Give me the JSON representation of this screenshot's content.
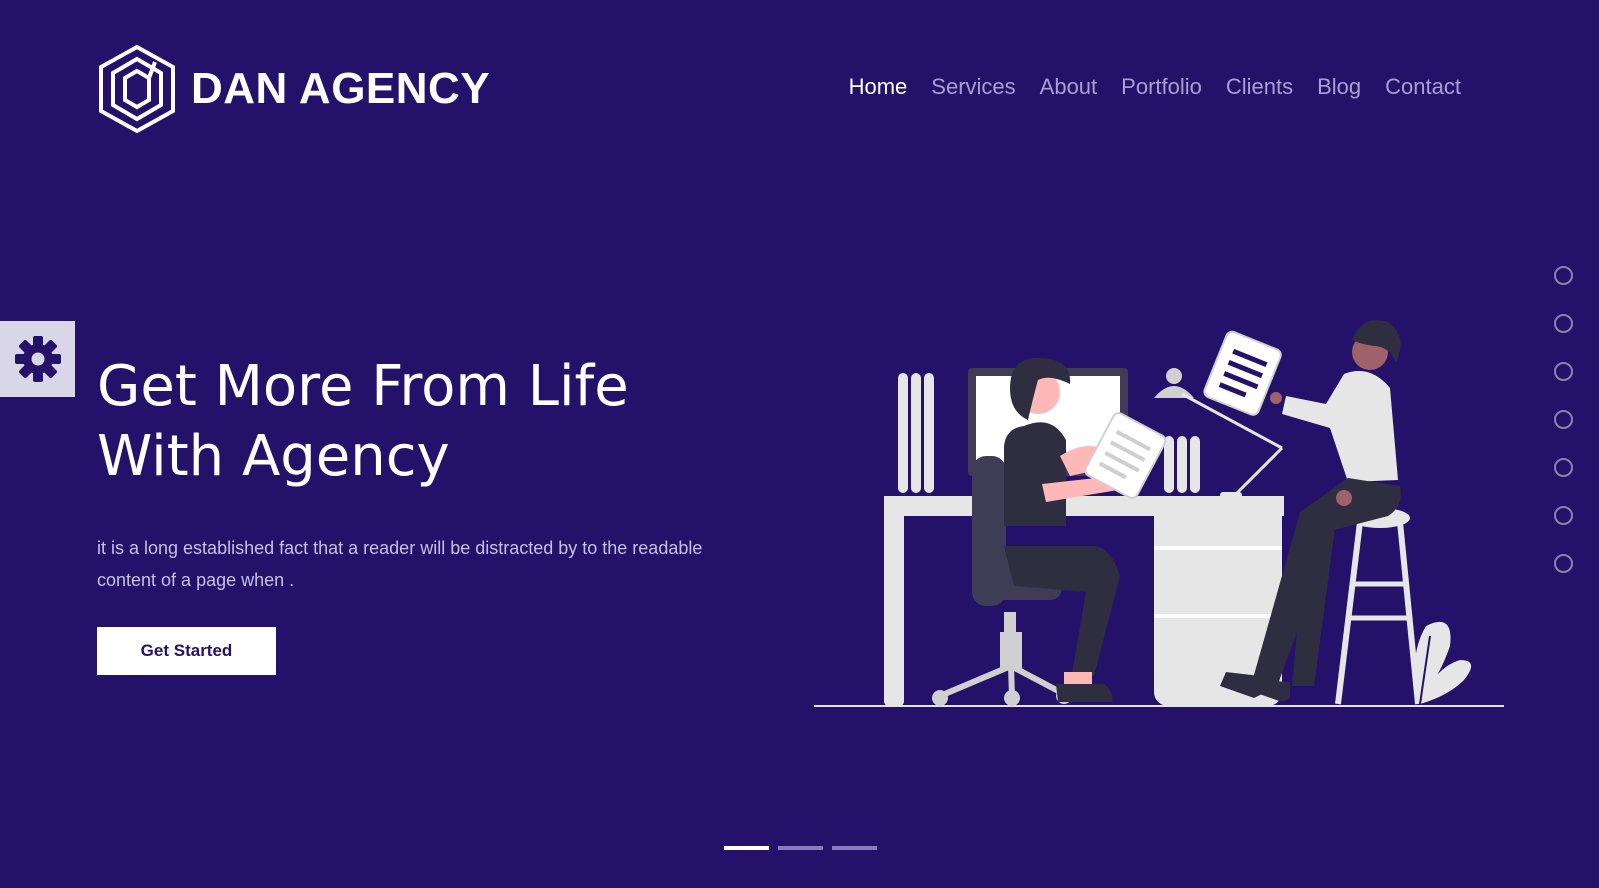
{
  "brand": {
    "name": "DAN AGENCY",
    "logo_icon": "hexagon-logo-icon"
  },
  "nav": {
    "items": [
      {
        "label": "Home",
        "active": true
      },
      {
        "label": "Services",
        "active": false
      },
      {
        "label": "About",
        "active": false
      },
      {
        "label": "Portfolio",
        "active": false
      },
      {
        "label": "Clients",
        "active": false
      },
      {
        "label": "Blog",
        "active": false
      },
      {
        "label": "Contact",
        "active": false
      }
    ]
  },
  "settings": {
    "icon": "gear-icon"
  },
  "hero": {
    "title_line1": "Get More From Life",
    "title_line2": "With Agency",
    "description": "it is a long established fact that a reader will be distracted by to the readable content of a page when .",
    "cta_label": "Get Started"
  },
  "side_dots": {
    "count": 7,
    "active_index": -1
  },
  "slider": {
    "count": 3,
    "active_index": 0
  },
  "colors": {
    "background": "#24126a",
    "accent_white": "#ffffff",
    "nav_inactive": "#a99fd0",
    "settings_tab": "#d9d6e8",
    "dot_border": "#8a85a8"
  }
}
